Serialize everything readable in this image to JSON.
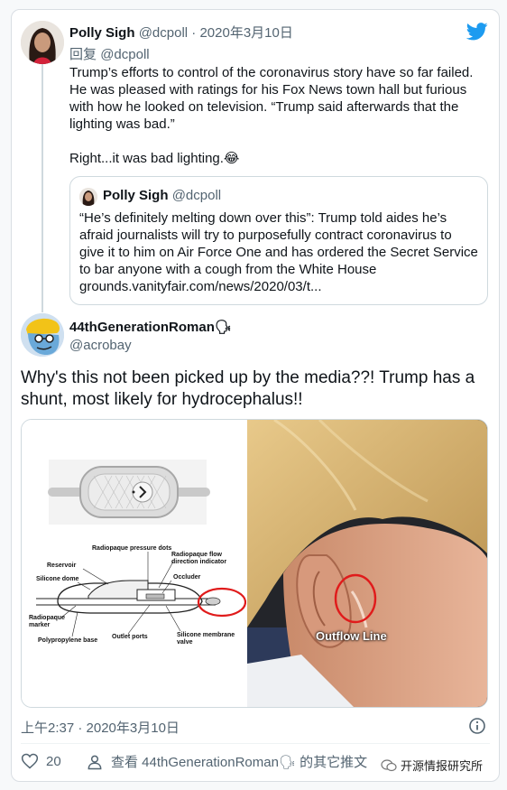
{
  "reply_tweet": {
    "name": "Polly Sigh",
    "handle": "@dcpoll",
    "separator": "·",
    "date": "2020年3月10日",
    "reply_label": "回复",
    "reply_to": "@dcpoll",
    "body": [
      "Trump’s efforts to control of the coronavirus story have so far failed. He was pleased with ratings for his Fox News town hall but furious with how he looked on television. “Trump said afterwards that the lighting was bad.”",
      "Right...it was bad lighting.😂"
    ],
    "quote": {
      "name": "Polly Sigh",
      "handle": "@dcpoll",
      "text": "“He’s definitely melting down over this”: Trump told aides he’s afraid journalists will try to purposefully contract coronavirus to give it to him on Air Force One and has ordered the Secret Service to bar anyone with a cough from the White House grounds.vanityfair.com/news/2020/03/t..."
    }
  },
  "main_tweet": {
    "name": "44thGenerationRoman",
    "name_emoji": "🗣",
    "handle": "@acrobay",
    "text": "Why's this not been picked up by the media??! Trump has a shunt, most likely for hydrocephalus!!",
    "media": {
      "diagram_labels": {
        "pressure_dots": "Radiopaque pressure dots",
        "reservoir": "Reservoir",
        "flow_indicator_1": "Radiopaque flow",
        "flow_indicator_2": "direction indicator",
        "silicone_dome": "Silicone dome",
        "occluder": "Occluder",
        "marker_1": "Radiopaque",
        "marker_2": "marker",
        "base": "Polypropylene base",
        "outlet_ports": "Outlet ports",
        "membrane_1": "Silicone membrane",
        "membrane_2": "valve"
      },
      "photo_caption": "Outflow Line",
      "annotation_color": "#e01b1b"
    },
    "timestamp": "上午2:37 · 2020年3月10日",
    "likes": "20",
    "more_tweets_prefix": "查看 44thGenerationRoman",
    "more_tweets_suffix": "的其它推文"
  },
  "watermark": "开源情报研究所",
  "colors": {
    "twitter_blue": "#1d9bf0",
    "like_red": "#f91880",
    "text_primary": "#0f1419",
    "text_secondary": "#536471"
  },
  "icons": [
    "twitter-bird-icon",
    "info-icon",
    "heart-icon",
    "person-icon",
    "speaking-head-emoji",
    "wechat-icon"
  ]
}
